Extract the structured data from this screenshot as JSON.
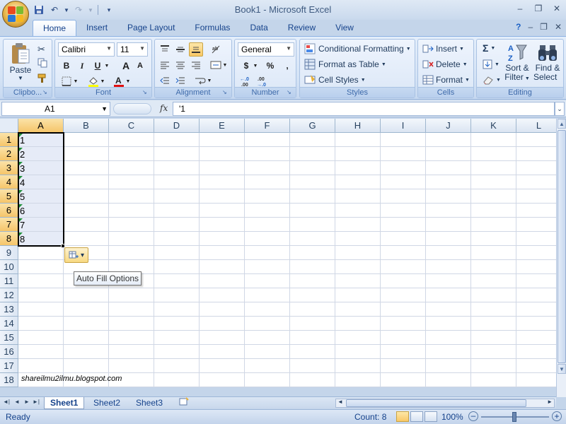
{
  "window": {
    "title": "Book1 - Microsoft Excel",
    "controls": [
      "–",
      "❐",
      "✕"
    ],
    "workbook_controls": [
      "?",
      "–",
      "❐",
      "✕"
    ]
  },
  "qat": {
    "icons": [
      "save-icon",
      "undo-icon",
      "redo-icon",
      "customize-icon"
    ]
  },
  "tabs": [
    {
      "label": "Home",
      "active": true
    },
    {
      "label": "Insert"
    },
    {
      "label": "Page Layout"
    },
    {
      "label": "Formulas"
    },
    {
      "label": "Data"
    },
    {
      "label": "Review"
    },
    {
      "label": "View"
    }
  ],
  "ribbon": {
    "clipboard": {
      "label": "Clipbo...",
      "paste": "Paste"
    },
    "font": {
      "label": "Font",
      "name": "Calibri",
      "size": "11",
      "bold": "B",
      "italic": "I",
      "underline": "U",
      "grow": "A",
      "shrink": "A"
    },
    "alignment": {
      "label": "Alignment"
    },
    "number": {
      "label": "Number",
      "format": "General",
      "currency": "$",
      "percent": "%",
      "comma": ",",
      "inc_decimal": "←.0\n.00",
      "dec_decimal": ".00\n→.0"
    },
    "styles": {
      "label": "Styles",
      "conditional": "Conditional Formatting",
      "format_table": "Format as Table",
      "cell_styles": "Cell Styles"
    },
    "cells": {
      "label": "Cells",
      "insert": "Insert",
      "delete": "Delete",
      "format": "Format"
    },
    "editing": {
      "label": "Editing",
      "sigma": "Σ",
      "sort_filter_1": "Sort &",
      "sort_filter_2": "Filter",
      "find_select_1": "Find &",
      "find_select_2": "Select"
    }
  },
  "formula_bar": {
    "name_box": "A1",
    "fx": "fx",
    "content": "'1"
  },
  "sheet": {
    "columns": [
      "A",
      "B",
      "C",
      "D",
      "E",
      "F",
      "G",
      "H",
      "I",
      "J",
      "K",
      "L"
    ],
    "rows": [
      "1",
      "2",
      "3",
      "4",
      "5",
      "6",
      "7",
      "8",
      "9",
      "10",
      "11",
      "12",
      "13",
      "14",
      "15",
      "16",
      "17",
      "18"
    ],
    "cells_a": [
      "1",
      "2",
      "3",
      "4",
      "5",
      "6",
      "7",
      "8"
    ],
    "watermark": "shareilmu2ilmu.blogspot.com",
    "tooltip": "Auto Fill Options"
  },
  "sheet_tabs": [
    "Sheet1",
    "Sheet2",
    "Sheet3"
  ],
  "status": {
    "ready": "Ready",
    "count": "Count: 8",
    "zoom": "100%"
  }
}
